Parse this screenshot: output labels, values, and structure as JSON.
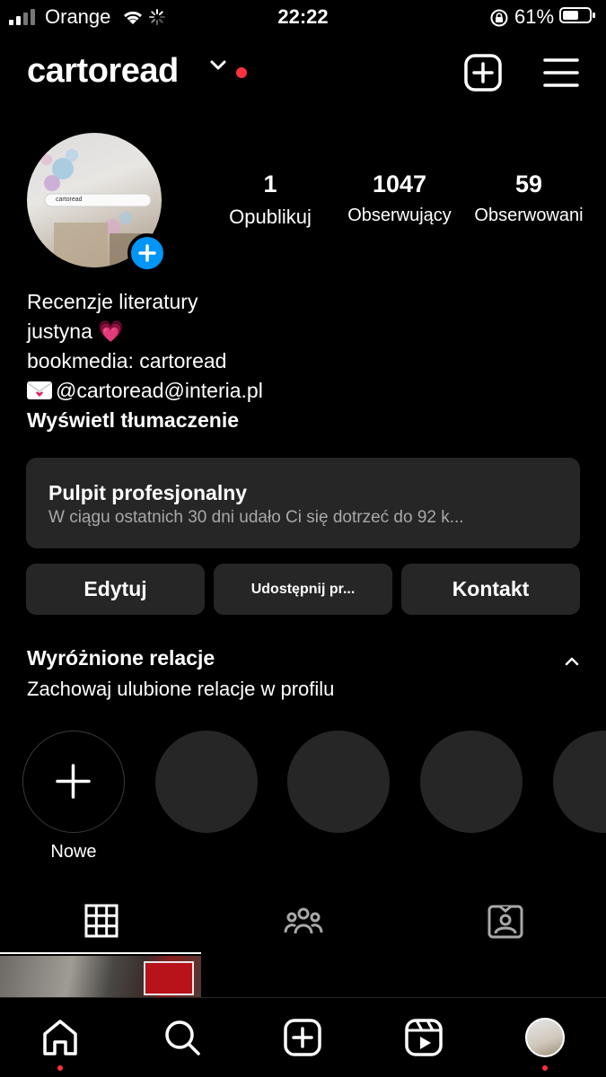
{
  "status_bar": {
    "carrier": "Orange",
    "time": "22:22",
    "battery_pct": "61%",
    "battery_level": 0.61
  },
  "header": {
    "username": "cartoread",
    "icons": [
      "chevron-down-icon",
      "new-post-icon",
      "menu-icon"
    ]
  },
  "avatar": {
    "caption": "cartoread"
  },
  "stats": [
    {
      "num": "1",
      "label": "Opublikuj"
    },
    {
      "num": "1047",
      "label": "Obserwujący"
    },
    {
      "num": "59",
      "label": "Obserwowani"
    }
  ],
  "bio": {
    "line1": "Recenzje literatury",
    "line2_name": "justyna",
    "line2_emoji": "💗",
    "line3": "bookmedia: cartoread",
    "line4": "@cartoread@interia.pl",
    "translate": "Wyświetl tłumaczenie"
  },
  "dashboard": {
    "title": "Pulpit profesjonalny",
    "subtitle": "W ciągu ostatnich 30 dni udało Ci się dotrzeć do 92 k..."
  },
  "buttons": {
    "edit": "Edytuj",
    "share": "Udostępnij pr...",
    "contact": "Kontakt"
  },
  "highlights": {
    "title": "Wyróżnione relacje",
    "subtitle": "Zachowaj ulubione relacje w profilu",
    "new_label": "Nowe"
  },
  "tabs": [
    "grid-icon",
    "tagged-people-icon",
    "tagged-photos-icon"
  ],
  "bottom_nav": [
    "home-icon",
    "search-icon",
    "create-icon",
    "reels-icon",
    "profile-icon"
  ],
  "colors": {
    "accent_blue": "#0095f6",
    "notification_red": "#ff3040",
    "surface": "#262626",
    "muted_text": "#a8a8a8"
  }
}
